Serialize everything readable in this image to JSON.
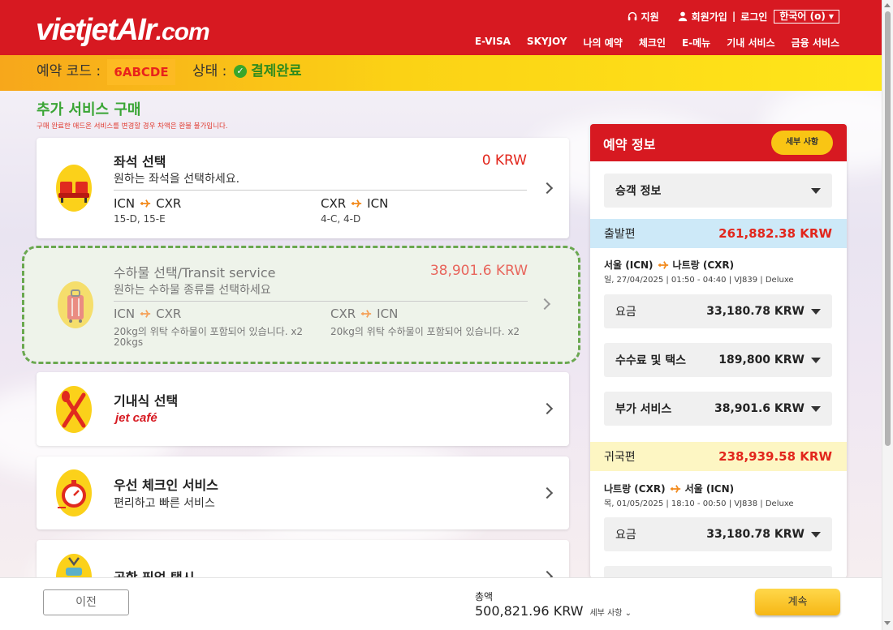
{
  "header": {
    "logo_main": "vietjet",
    "logo_air": "AIr",
    "logo_com": ".com",
    "support": "지원",
    "signup": "회원가입",
    "login": "로그인",
    "language": "한국어 (o)",
    "nav": [
      "E-VISA",
      "SKYJOY",
      "나의 예약",
      "체크인",
      "E-메뉴",
      "기내 서비스",
      "금융 서비스"
    ]
  },
  "booking": {
    "code_label": "예약 코드 :",
    "code": "6ABCDE",
    "status_label": "상태 :",
    "status": "결제완료"
  },
  "page": {
    "title": "추가 서비스 구매",
    "note": "구매 완료한 애드온 서비스를 변경할 경우 차액은 환불 불가입니다."
  },
  "services": {
    "seat": {
      "title": "좌석 선택",
      "subtitle": "원하는 좌석을 선택하세요.",
      "price": "0 KRW",
      "outbound": {
        "from": "ICN",
        "to": "CXR",
        "detail": "15-D, 15-E"
      },
      "return": {
        "from": "CXR",
        "to": "ICN",
        "detail": "4-C, 4-D"
      }
    },
    "baggage": {
      "title": "수하물 선택/Transit service",
      "subtitle": "원하는 수하물 종류를 선택하세요",
      "price": "38,901.6 KRW",
      "outbound": {
        "from": "ICN",
        "to": "CXR",
        "detail": "20kg의 위탁 수하물이 포함되어 있습니다. x2",
        "detail2": "20kgs"
      },
      "return": {
        "from": "CXR",
        "to": "ICN",
        "detail": "20kg의 위탁 수하물이 포함되어 있습니다. x2"
      }
    },
    "meal": {
      "title": "기내식 선택",
      "brand": "jet café"
    },
    "priority": {
      "title": "우선 체크인 서비스",
      "subtitle": "편리하고 빠른 서비스"
    },
    "pickup": {
      "title": "공항 픽업 택시"
    }
  },
  "summary": {
    "title": "예약 정보",
    "detail_button": "세부 사항",
    "passenger": "승객 정보",
    "outbound": {
      "label": "출발편",
      "amount": "261,882.38 KRW",
      "route_from": "서울 (ICN)",
      "route_to": "나트랑 (CXR)",
      "info": "일, 27/04/2025 | 01:50 - 04:40 | VJ839 | Deluxe",
      "fare_label": "요금",
      "fare": "33,180.78 KRW",
      "tax_label": "수수료 및 택스",
      "tax": "189,800 KRW",
      "addon_label": "부가 서비스",
      "addon": "38,901.6 KRW"
    },
    "return": {
      "label": "귀국편",
      "amount": "238,939.58 KRW",
      "route_from": "나트랑 (CXR)",
      "route_to": "서울 (ICN)",
      "info": "목, 01/05/2025 | 18:10 - 00:50 | VJ838 | Deluxe",
      "fare_label": "요금",
      "fare": "33,180.78 KRW"
    }
  },
  "footer": {
    "prev": "이전",
    "total_label": "총액",
    "total": "500,821.96 KRW",
    "total_detail": "세부 사항",
    "next": "계속"
  },
  "colors": {
    "brand_red": "#d71921",
    "accent_yellow": "#f9c514",
    "success_green": "#3aa535"
  }
}
